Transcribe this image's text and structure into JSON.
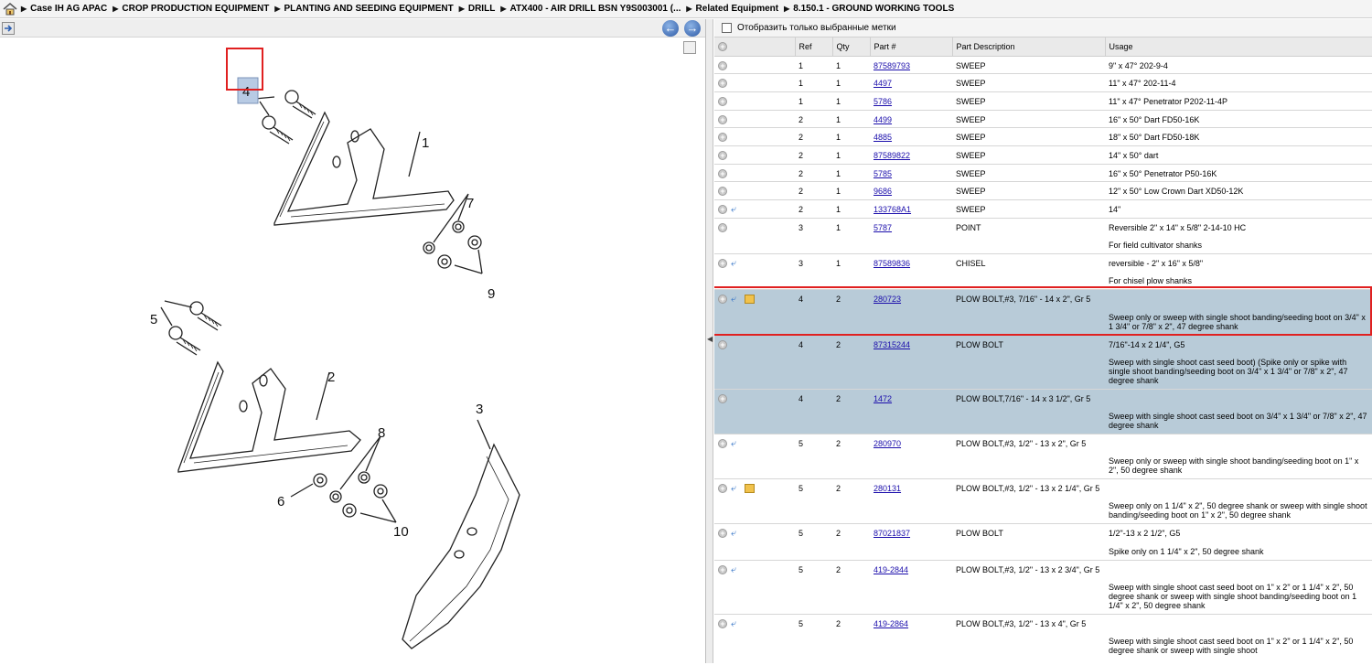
{
  "breadcrumb": [
    "Case IH AG APAC",
    "CROP PRODUCTION EQUIPMENT",
    "PLANTING AND SEEDING EQUIPMENT",
    "DRILL",
    "ATX400 - AIR DRILL BSN Y9S003001 (...",
    "Related Equipment",
    "8.150.1 - GROUND WORKING TOOLS"
  ],
  "filter": {
    "label": "Отобразить только выбранные метки"
  },
  "table": {
    "headers": {
      "ref": "Ref",
      "qty": "Qty",
      "part": "Part #",
      "desc": "Part Description",
      "usage": "Usage"
    },
    "rows": [
      {
        "ref": "1",
        "qty": "1",
        "part": "87589793",
        "desc": "SWEEP",
        "usage": "9\" x 47° 202-9-4",
        "note": "",
        "icons": []
      },
      {
        "ref": "1",
        "qty": "1",
        "part": "4497",
        "desc": "SWEEP",
        "usage": "11\" x 47° 202-11-4",
        "note": "",
        "icons": []
      },
      {
        "ref": "1",
        "qty": "1",
        "part": "5786",
        "desc": "SWEEP",
        "usage": "11\" x 47° Penetrator P202-11-4P",
        "note": "",
        "icons": []
      },
      {
        "ref": "2",
        "qty": "1",
        "part": "4499",
        "desc": "SWEEP",
        "usage": "16\" x 50° Dart FD50-16K",
        "note": "",
        "icons": []
      },
      {
        "ref": "2",
        "qty": "1",
        "part": "4885",
        "desc": "SWEEP",
        "usage": "18\" x 50° Dart FD50-18K",
        "note": "",
        "icons": []
      },
      {
        "ref": "2",
        "qty": "1",
        "part": "87589822",
        "desc": "SWEEP",
        "usage": "14\" x 50° dart",
        "note": "",
        "icons": []
      },
      {
        "ref": "2",
        "qty": "1",
        "part": "5785",
        "desc": "SWEEP",
        "usage": "16\" x 50° Penetrator P50-16K",
        "note": "",
        "icons": []
      },
      {
        "ref": "2",
        "qty": "1",
        "part": "9686",
        "desc": "SWEEP",
        "usage": "12\" x 50° Low Crown Dart XD50-12K",
        "note": "",
        "icons": []
      },
      {
        "ref": "2",
        "qty": "1",
        "part": "133768A1",
        "desc": "SWEEP",
        "usage": "14\"",
        "note": "",
        "icons": [
          "link"
        ]
      },
      {
        "ref": "3",
        "qty": "1",
        "part": "5787",
        "desc": "POINT",
        "usage": "Reversible 2\" x 14\" x 5/8\" 2-14-10 HC",
        "note": "For field cultivator shanks",
        "icons": []
      },
      {
        "ref": "3",
        "qty": "1",
        "part": "87589836",
        "desc": "CHISEL",
        "usage": "reversible - 2\" x 16\" x 5/8\"",
        "note": "For chisel plow shanks",
        "icons": [
          "link"
        ]
      },
      {
        "ref": "4",
        "qty": "2",
        "part": "280723",
        "desc": "PLOW BOLT,#3, 7/16\" - 14 x 2\", Gr 5",
        "usage": "",
        "note": "Sweep only or sweep with single shoot banding/seeding boot on 3/4\" x 1 3/4\" or 7/8\" x 2\", 47 degree shank",
        "icons": [
          "link",
          "box"
        ],
        "selected": true
      },
      {
        "ref": "4",
        "qty": "2",
        "part": "87315244",
        "desc": "PLOW BOLT",
        "usage": "7/16\"-14 x 2 1/4\", G5",
        "note": "Sweep with single shoot cast seed boot) (Spike only or spike with single shoot banding/seeding boot on 3/4\" x 1 3/4\" or 7/8\" x 2\", 47 degree shank",
        "icons": [],
        "selected": true
      },
      {
        "ref": "4",
        "qty": "2",
        "part": "1472",
        "desc": "PLOW BOLT,7/16\" - 14 x 3 1/2\", Gr 5",
        "usage": "",
        "note": "Sweep with single shoot cast seed boot on 3/4\" x 1 3/4\" or 7/8\" x 2\", 47 degree shank",
        "icons": [],
        "selected": true
      },
      {
        "ref": "5",
        "qty": "2",
        "part": "280970",
        "desc": "PLOW BOLT,#3, 1/2\" - 13 x 2\", Gr 5",
        "usage": "",
        "note": "Sweep only or sweep with single shoot banding/seeding boot on 1\" x 2\", 50 degree shank",
        "icons": [
          "link"
        ]
      },
      {
        "ref": "5",
        "qty": "2",
        "part": "280131",
        "desc": "PLOW BOLT,#3, 1/2\" - 13 x 2 1/4\", Gr 5",
        "usage": "",
        "note": "Sweep only on 1 1/4\" x 2\", 50 degree shank or sweep with single shoot banding/seeding boot on 1\" x 2\", 50 degree shank",
        "icons": [
          "link",
          "box"
        ]
      },
      {
        "ref": "5",
        "qty": "2",
        "part": "87021837",
        "desc": "PLOW BOLT",
        "usage": "1/2\"-13 x 2 1/2\", G5",
        "note": "Spike only on 1 1/4\" x 2\", 50 degree shank",
        "icons": [
          "link"
        ]
      },
      {
        "ref": "5",
        "qty": "2",
        "part": "419-2844",
        "desc": "PLOW BOLT,#3, 1/2\" - 13 x 2 3/4\", Gr 5",
        "usage": "",
        "note": "Sweep with single shoot cast seed boot on 1\" x 2\" or 1 1/4\" x 2\", 50 degree shank or sweep with single shoot banding/seeding boot on 1 1/4\" x 2\", 50 degree shank",
        "icons": [
          "link"
        ]
      },
      {
        "ref": "5",
        "qty": "2",
        "part": "419-2864",
        "desc": "PLOW BOLT,#3, 1/2\" - 13 x 4\", Gr 5",
        "usage": "",
        "note": "Sweep with single shoot cast seed boot on 1\" x 2\" or 1 1/4\" x 2\", 50 degree shank or sweep with single shoot",
        "icons": [
          "link"
        ]
      }
    ]
  },
  "diagram": {
    "callouts": [
      "4",
      "1",
      "7",
      "9",
      "5",
      "2",
      "8",
      "6",
      "10",
      "3"
    ]
  },
  "colors": {
    "selected_row": "#b8cbd8",
    "highlight": "#e02020",
    "link": "#1a0dab"
  }
}
